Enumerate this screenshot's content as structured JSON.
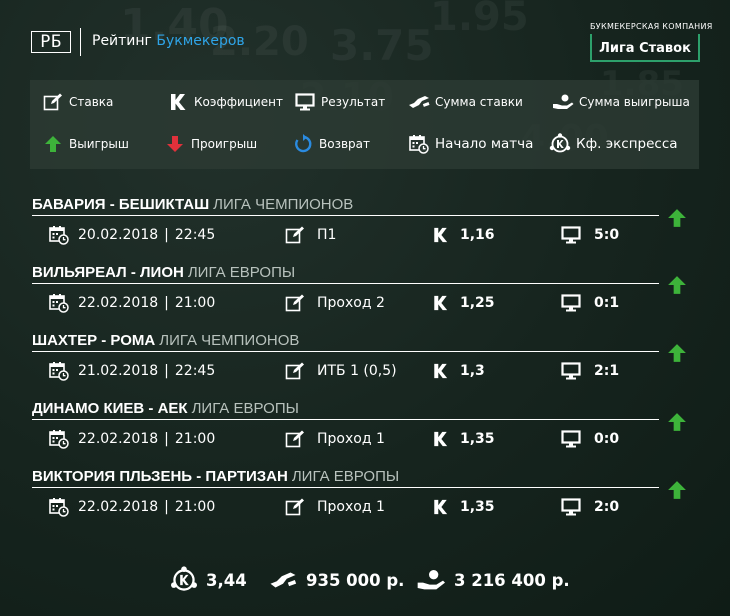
{
  "header": {
    "logo_abbr": "РБ",
    "title_part1": "Рейтинг ",
    "title_part2": "Букмекеров",
    "partner_caption": "БУКМЕКЕРСКАЯ КОМПАНИЯ",
    "partner_name": "Лига Ставок",
    "accent_color": "#2fa4e7",
    "partner_color": "#2da06b"
  },
  "legend": {
    "items": [
      {
        "icon": "edit-icon",
        "label": "Ставка"
      },
      {
        "icon": "k-coefficient-icon",
        "label": "Коэффициент"
      },
      {
        "icon": "monitor-icon",
        "label": "Результат"
      },
      {
        "icon": "money-throw-icon",
        "label": "Сумма ставки"
      },
      {
        "icon": "money-hand-icon",
        "label": "Сумма выигрыша"
      },
      {
        "icon": "arrow-up-icon",
        "label": "Выигрыш"
      },
      {
        "icon": "arrow-down-icon",
        "label": "Проигрыш"
      },
      {
        "icon": "refund-icon",
        "label": "Возврат"
      },
      {
        "icon": "calendar-clock-icon",
        "label": "Начало матча"
      },
      {
        "icon": "express-k-icon",
        "label": "Кф. экспресса"
      }
    ]
  },
  "matches": [
    {
      "title": "БАВАРИЯ - БЕШИКТАШ",
      "league": "ЛИГА ЧЕМПИОНОВ",
      "date": "20.02.2018",
      "time": "22:45",
      "bet": "П1",
      "coef": "1,16",
      "result": "5:0",
      "status": "win"
    },
    {
      "title": "ВИЛЬЯРЕАЛ - ЛИОН",
      "league": "ЛИГА ЕВРОПЫ",
      "date": "22.02.2018",
      "time": "21:00",
      "bet": "Проход 2",
      "coef": "1,25",
      "result": "0:1",
      "status": "win"
    },
    {
      "title": "ШАХТЕР - РОМА",
      "league": "ЛИГА ЧЕМПИОНОВ",
      "date": "21.02.2018",
      "time": "22:45",
      "bet": "ИТБ 1 (0,5)",
      "coef": "1,3",
      "result": "2:1",
      "status": "win"
    },
    {
      "title": "ДИНАМО КИЕВ - АЕК",
      "league": "ЛИГА ЕВРОПЫ",
      "date": "22.02.2018",
      "time": "21:00",
      "bet": "Проход 1",
      "coef": "1,35",
      "result": "0:0",
      "status": "win"
    },
    {
      "title": "ВИКТОРИЯ ПЛЬЗЕНЬ - ПАРТИЗАН",
      "league": "ЛИГА ЕВРОПЫ",
      "date": "22.02.2018",
      "time": "21:00",
      "bet": "Проход 1",
      "coef": "1,35",
      "result": "2:0",
      "status": "win"
    }
  ],
  "totals": {
    "express_coef": "3,44",
    "stake": "935 000 р.",
    "payout": "3 216 400 р."
  },
  "colors": {
    "win": "#3db33a",
    "lose": "#e0313b",
    "refund": "#2a8be0"
  }
}
